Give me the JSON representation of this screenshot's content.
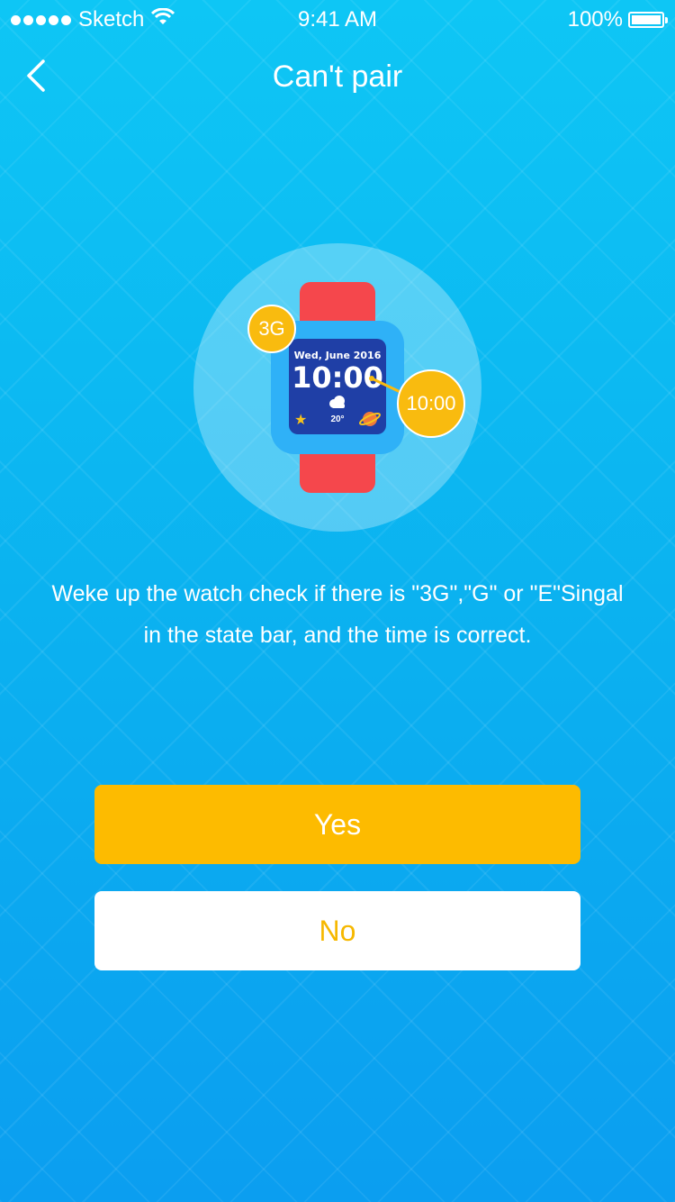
{
  "status_bar": {
    "carrier": "Sketch",
    "time": "9:41 AM",
    "battery": "100%"
  },
  "nav": {
    "title": "Can't pair",
    "back_icon": "chevron-left-icon"
  },
  "illustration": {
    "signal_badge": "3G",
    "time_badge": "10:00",
    "watch_date": "Wed, June 2016",
    "watch_time": "10:00",
    "watch_temp": "20°"
  },
  "instruction": {
    "line1": "Weke up the watch check if there is \"3G\",\"G\" or \"E\"Singal",
    "line2": "in the state bar, and the time is correct."
  },
  "buttons": {
    "yes_label": "Yes",
    "no_label": "No"
  },
  "colors": {
    "accent": "#fdbb00",
    "background_top": "#0ec6f5",
    "background_bottom": "#0b9ef0"
  }
}
